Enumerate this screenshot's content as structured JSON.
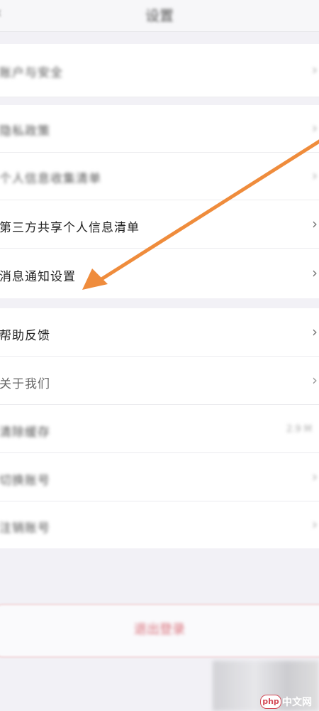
{
  "header": {
    "title": "设置",
    "back_icon": "‹"
  },
  "rows": [
    {
      "label": "账户与安全",
      "chevron": "›"
    },
    {
      "label": "隐私政策",
      "chevron": "›"
    },
    {
      "label": "个人信息收集清单",
      "chevron": "›"
    },
    {
      "label": "第三方共享个人信息清单",
      "chevron": "›"
    },
    {
      "label": "消息通知设置",
      "chevron": "›"
    },
    {
      "label": "帮助反馈",
      "chevron": "›"
    },
    {
      "label": "关于我们",
      "chevron": "›"
    },
    {
      "label": "清除缓存",
      "value": "2.9 M",
      "chevron": ""
    },
    {
      "label": "切换账号",
      "chevron": "›"
    },
    {
      "label": "注销账号",
      "chevron": "›"
    }
  ],
  "logout": {
    "label": "退出登录"
  },
  "watermark": {
    "badge": "php",
    "site": "中文网"
  },
  "colors": {
    "arrow": "#ef8c3c",
    "logout_text": "#d9707a"
  }
}
